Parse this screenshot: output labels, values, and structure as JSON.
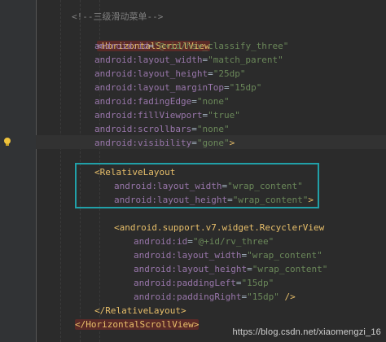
{
  "lines": [
    {
      "type": "comment",
      "text": "<!--三级滑动菜单-->"
    },
    {
      "type": "open_tag_start",
      "tag": "HorizontalScrollView"
    },
    {
      "type": "attr",
      "name": "android:id",
      "value": "\"@+id/hsv_classify_three\""
    },
    {
      "type": "attr",
      "name": "android:layout_width",
      "value": "\"match_parent\""
    },
    {
      "type": "attr",
      "name": "android:layout_height",
      "value": "\"25dp\""
    },
    {
      "type": "attr",
      "name": "android:layout_marginTop",
      "value": "\"15dp\""
    },
    {
      "type": "attr",
      "name": "android:fadingEdge",
      "value": "\"none\""
    },
    {
      "type": "attr",
      "name": "android:fillViewport",
      "value": "\"true\""
    },
    {
      "type": "attr",
      "name": "android:scrollbars",
      "value": "\"none\""
    },
    {
      "type": "attr_end",
      "name": "android:visibility",
      "value": "\"gone\"",
      "end": ">"
    },
    {
      "type": "open_tag_start",
      "tag": "RelativeLayout"
    },
    {
      "type": "attr",
      "name": "android:layout_width",
      "value": "\"wrap_content\""
    },
    {
      "type": "attr_end",
      "name": "android:layout_height",
      "value": "\"wrap_content\"",
      "end": ">"
    },
    {
      "type": "open_tag_start",
      "tag": "android.support.v7.widget.RecyclerView"
    },
    {
      "type": "attr",
      "name": "android:id",
      "value": "\"@+id/rv_three\""
    },
    {
      "type": "attr",
      "name": "android:layout_width",
      "value": "\"wrap_content\""
    },
    {
      "type": "attr",
      "name": "android:layout_height",
      "value": "\"wrap_content\""
    },
    {
      "type": "attr",
      "name": "android:paddingLeft",
      "value": "\"15dp\""
    },
    {
      "type": "attr_end",
      "name": "android:paddingRight",
      "value": "\"15dp\"",
      "end": " />"
    },
    {
      "type": "close_tag",
      "tag": "RelativeLayout"
    },
    {
      "type": "close_tag",
      "tag": "HorizontalScrollView"
    }
  ],
  "watermark": "https://blog.csdn.net/xiaomengzi_16",
  "colors": {
    "background": "#2b2b2b",
    "tag": "#e8bf6a",
    "attribute": "#9876aa",
    "value": "#6a8759",
    "comment": "#808080",
    "highlight_box": "#21a0a8"
  },
  "icons": [
    "lightbulb-icon"
  ]
}
